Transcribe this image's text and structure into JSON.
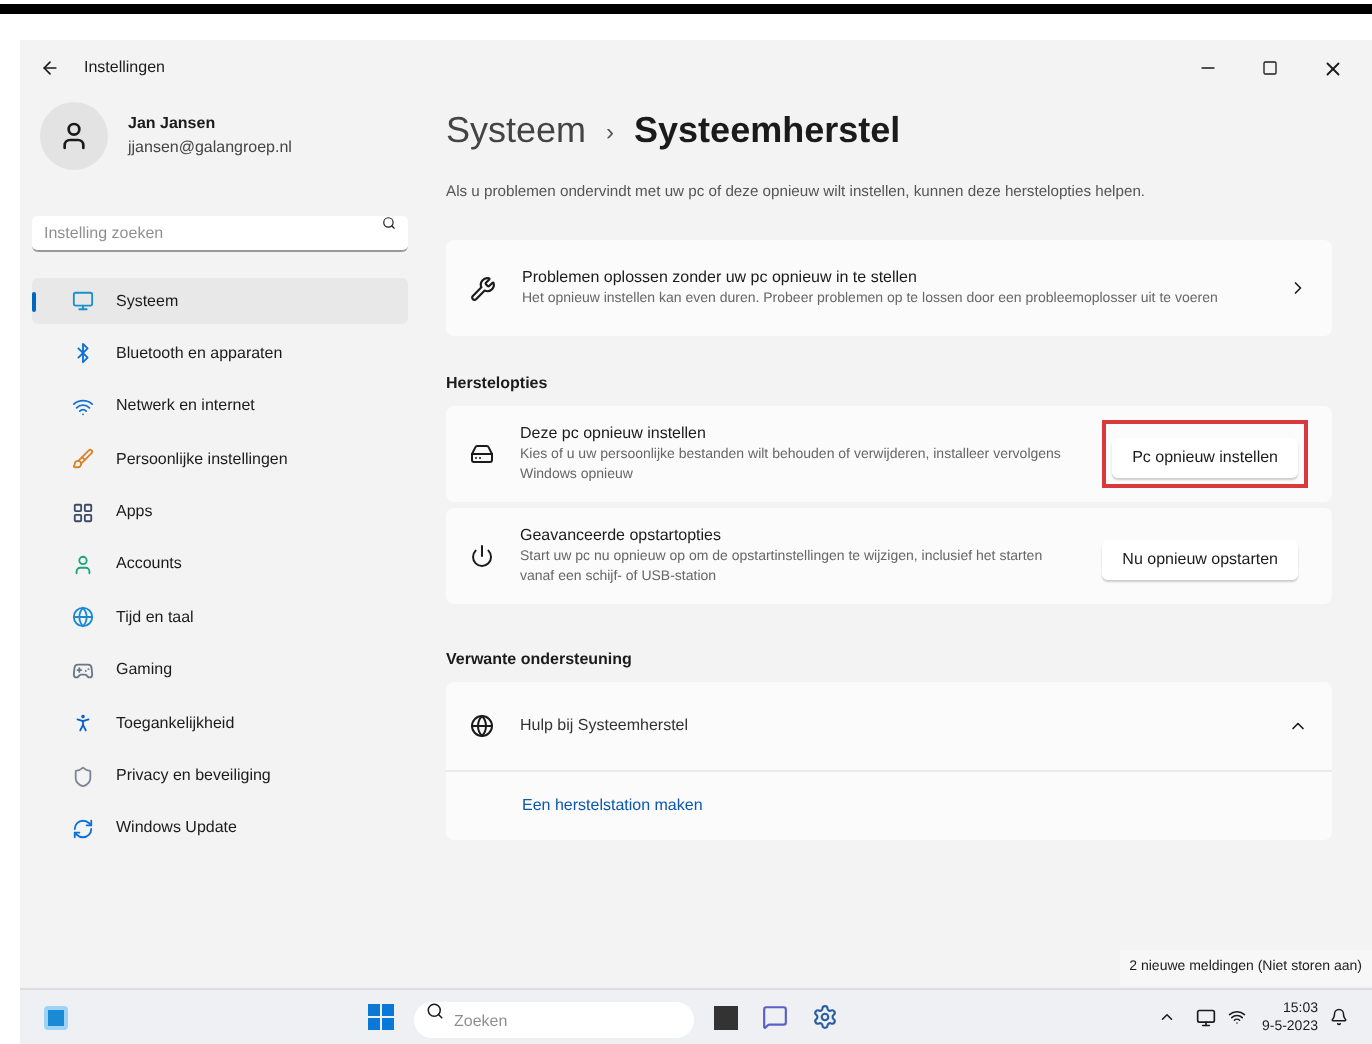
{
  "window": {
    "title": "Instellingen"
  },
  "user": {
    "name": "Jan Jansen",
    "email": "jjansen@galangroep.nl"
  },
  "search": {
    "placeholder": "Instelling zoeken"
  },
  "sidebar": {
    "items": [
      {
        "label": "Systeem",
        "selected": true
      },
      {
        "label": "Bluetooth en apparaten",
        "selected": false
      },
      {
        "label": "Netwerk en internet",
        "selected": false
      },
      {
        "label": "Persoonlijke instellingen",
        "selected": false
      },
      {
        "label": "Apps",
        "selected": false
      },
      {
        "label": "Accounts",
        "selected": false
      },
      {
        "label": "Tijd en taal",
        "selected": false
      },
      {
        "label": "Gaming",
        "selected": false
      },
      {
        "label": "Toegankelijkheid",
        "selected": false
      },
      {
        "label": "Privacy en beveiliging",
        "selected": false
      },
      {
        "label": "Windows Update",
        "selected": false
      }
    ]
  },
  "breadcrumb": {
    "parent": "Systeem",
    "separator": "›",
    "current": "Systeemherstel"
  },
  "intro": "Als u problemen ondervindt met uw pc of deze opnieuw wilt instellen, kunnen deze herstelopties helpen.",
  "troubleshoot_card": {
    "title": "Problemen oplossen zonder uw pc opnieuw in te stellen",
    "description": "Het opnieuw instellen kan even duren. Probeer problemen op te lossen door een probleemoplosser uit te voeren"
  },
  "recovery_section": {
    "heading": "Herstelopties",
    "options": [
      {
        "title": "Deze pc opnieuw instellen",
        "description": "Kies of u uw persoonlijke bestanden wilt behouden of verwijderen, installeer vervolgens Windows opnieuw",
        "button": "Pc opnieuw instellen",
        "highlighted": true
      },
      {
        "title": "Geavanceerde opstartopties",
        "description": "Start uw pc nu opnieuw op om de opstartinstellingen te wijzigen, inclusief het starten vanaf een schijf- of USB-station",
        "button": "Nu opnieuw opstarten",
        "highlighted": false
      }
    ]
  },
  "support_section": {
    "heading": "Verwante ondersteuning",
    "help": {
      "title": "Hulp bij Systeemherstel",
      "expanded": true,
      "link": "Een herstelstation maken"
    }
  },
  "notification": "2 nieuwe meldingen (Niet storen aan)",
  "taskbar": {
    "search_placeholder": "Zoeken",
    "time": "15:03",
    "date": "9-5-2023"
  }
}
